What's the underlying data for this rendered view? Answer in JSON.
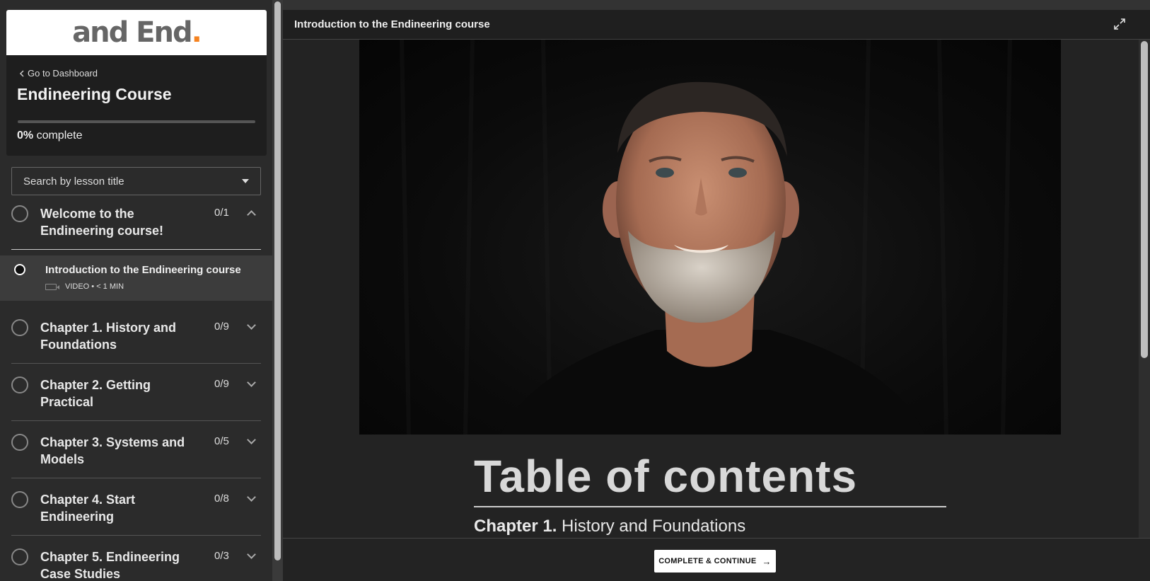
{
  "sidebar": {
    "logo_text": "and End",
    "logo_dot": ".",
    "back_link": "Go to Dashboard",
    "course_title": "Endineering Course",
    "progress_percent_label": "0%",
    "progress_suffix": "complete",
    "progress_fraction": 0,
    "search_placeholder": "Search by lesson title",
    "chapters": [
      {
        "title": "Welcome to the Endineering course!",
        "count": "0/1",
        "expanded": true,
        "lessons": [
          {
            "title": "Introduction to the Endineering course",
            "meta": "VIDEO • < 1 MIN"
          }
        ]
      },
      {
        "title": "Chapter 1. History and Foundations",
        "count": "0/9",
        "expanded": false
      },
      {
        "title": "Chapter 2. Getting Practical",
        "count": "0/9",
        "expanded": false
      },
      {
        "title": "Chapter 3. Systems and Models",
        "count": "0/5",
        "expanded": false
      },
      {
        "title": "Chapter 4. Start Endineering",
        "count": "0/8",
        "expanded": false
      },
      {
        "title": "Chapter 5. Endineering Case Studies",
        "count": "0/3",
        "expanded": false
      }
    ]
  },
  "main": {
    "header_title": "Introduction to the Endineering course",
    "toc_title": "Table of contents",
    "toc_first_prefix": "Chapter 1.",
    "toc_first_text": "History and Foundations",
    "cta_label": "COMPLETE & CONTINUE",
    "cta_arrow": "→"
  },
  "colors": {
    "accent": "#f5821f",
    "sidebar_bg": "#2b2b2b",
    "main_bg": "#232323"
  }
}
